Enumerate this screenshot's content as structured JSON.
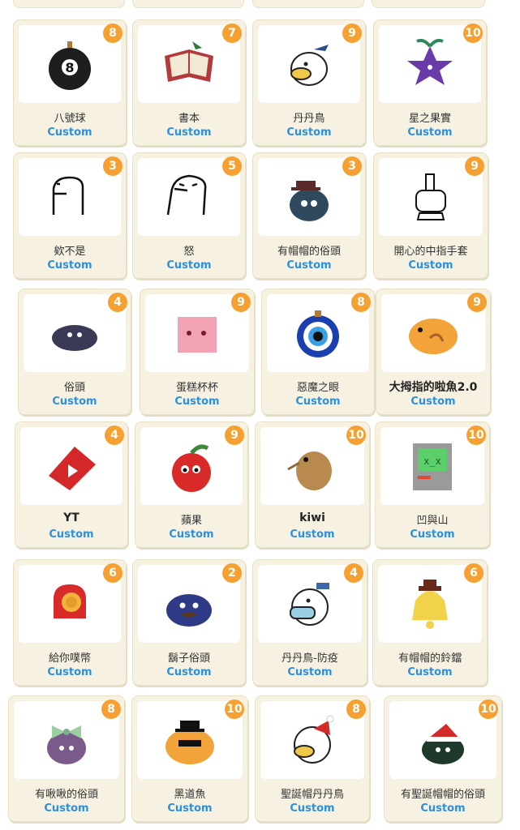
{
  "colors": {
    "badge": "#f5a030",
    "custom_label": "#2d8fe0",
    "card_bg": "#f6f1e0"
  },
  "items": [
    {
      "name": "八號球",
      "sub": "Custom",
      "badge": "8",
      "icon": "eight-ball-icon"
    },
    {
      "name": "書本",
      "sub": "Custom",
      "badge": "7",
      "icon": "book-icon"
    },
    {
      "name": "丹丹鳥",
      "sub": "Custom",
      "badge": "9",
      "icon": "dandan-bird-icon"
    },
    {
      "name": "星之果實",
      "sub": "Custom",
      "badge": "10",
      "icon": "star-fruit-icon"
    },
    {
      "name": "欸不是",
      "sub": "Custom",
      "badge": "3",
      "icon": "dino-outline-icon"
    },
    {
      "name": "怒",
      "sub": "Custom",
      "badge": "5",
      "icon": "angry-dino-icon"
    },
    {
      "name": "有帽帽的俗頭",
      "sub": "Custom",
      "badge": "3",
      "icon": "hat-blob-icon"
    },
    {
      "name": "開心的中指手套",
      "sub": "Custom",
      "badge": "9",
      "icon": "glove-icon"
    },
    {
      "name": "俗頭",
      "sub": "Custom",
      "badge": "4",
      "icon": "blob-icon"
    },
    {
      "name": "蛋糕杯杯",
      "sub": "Custom",
      "badge": "9",
      "icon": "cupcake-icon"
    },
    {
      "name": "惡魔之眼",
      "sub": "Custom",
      "badge": "8",
      "icon": "evil-eye-icon"
    },
    {
      "name": "大拇指的啦魚2.0",
      "sub": "Custom",
      "badge": "9",
      "icon": "taiyaki-icon"
    },
    {
      "name": "YT",
      "sub": "Custom",
      "badge": "4",
      "icon": "youtube-icon"
    },
    {
      "name": "蘋果",
      "sub": "Custom",
      "badge": "9",
      "icon": "apple-icon"
    },
    {
      "name": "kiwi",
      "sub": "Custom",
      "badge": "10",
      "icon": "kiwi-bird-icon"
    },
    {
      "name": "凹與山",
      "sub": "Custom",
      "badge": "10",
      "icon": "computer-icon"
    },
    {
      "name": "給你噗幣",
      "sub": "Custom",
      "badge": "6",
      "icon": "mitten-coin-icon"
    },
    {
      "name": "鬍子俗頭",
      "sub": "Custom",
      "badge": "2",
      "icon": "mustache-blob-icon"
    },
    {
      "name": "丹丹鳥-防疫",
      "sub": "Custom",
      "badge": "4",
      "icon": "masked-bird-icon"
    },
    {
      "name": "有帽帽的鈴鐺",
      "sub": "Custom",
      "badge": "6",
      "icon": "bell-icon"
    },
    {
      "name": "有啾啾的俗頭",
      "sub": "Custom",
      "badge": "8",
      "icon": "bow-blob-icon"
    },
    {
      "name": "黑道魚",
      "sub": "Custom",
      "badge": "10",
      "icon": "gangster-fish-icon"
    },
    {
      "name": "聖誕帽丹丹鳥",
      "sub": "Custom",
      "badge": "8",
      "icon": "santa-bird-icon"
    },
    {
      "name": "有聖誕帽帽的俗頭",
      "sub": "Custom",
      "badge": "10",
      "icon": "santa-blob-icon"
    }
  ]
}
